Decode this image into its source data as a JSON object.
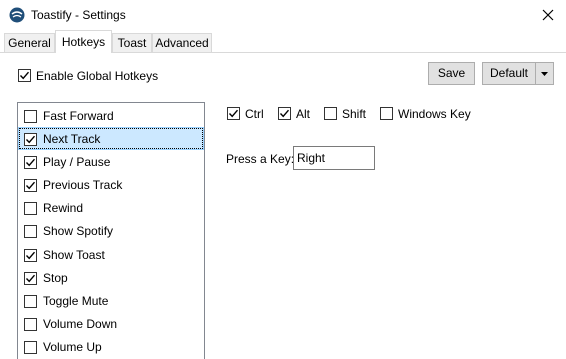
{
  "window": {
    "title": "Toastify - Settings"
  },
  "tabs": [
    {
      "label": "General",
      "active": false
    },
    {
      "label": "Hotkeys",
      "active": true
    },
    {
      "label": "Toast",
      "active": false
    },
    {
      "label": "Advanced",
      "active": false
    }
  ],
  "hotkeys": {
    "enable_global": {
      "label": "Enable Global Hotkeys",
      "checked": true
    },
    "save_label": "Save",
    "default_label": "Default",
    "actions": [
      {
        "label": "Fast Forward",
        "checked": false,
        "selected": false
      },
      {
        "label": "Next Track",
        "checked": true,
        "selected": true
      },
      {
        "label": "Play / Pause",
        "checked": true,
        "selected": false
      },
      {
        "label": "Previous Track",
        "checked": true,
        "selected": false
      },
      {
        "label": "Rewind",
        "checked": false,
        "selected": false
      },
      {
        "label": "Show Spotify",
        "checked": false,
        "selected": false
      },
      {
        "label": "Show Toast",
        "checked": true,
        "selected": false
      },
      {
        "label": "Stop",
        "checked": true,
        "selected": false
      },
      {
        "label": "Toggle Mute",
        "checked": false,
        "selected": false
      },
      {
        "label": "Volume Down",
        "checked": false,
        "selected": false
      },
      {
        "label": "Volume Up",
        "checked": false,
        "selected": false
      }
    ],
    "modifiers": {
      "ctrl": {
        "label": "Ctrl",
        "checked": true
      },
      "alt": {
        "label": "Alt",
        "checked": true
      },
      "shift": {
        "label": "Shift",
        "checked": false
      },
      "win": {
        "label": "Windows Key",
        "checked": false
      }
    },
    "key": {
      "label": "Press a Key:",
      "value": "Right"
    }
  },
  "colors": {
    "selection_bg": "#cce8ff",
    "button_bg": "#e1e1e1",
    "tab_inactive_bg": "#f0f0f0",
    "app_icon": "#1f4e79"
  },
  "icons": {
    "app": "toastify-app-icon",
    "close": "close-icon",
    "dropdown": "chevron-down-icon",
    "check": "checkmark-icon"
  }
}
